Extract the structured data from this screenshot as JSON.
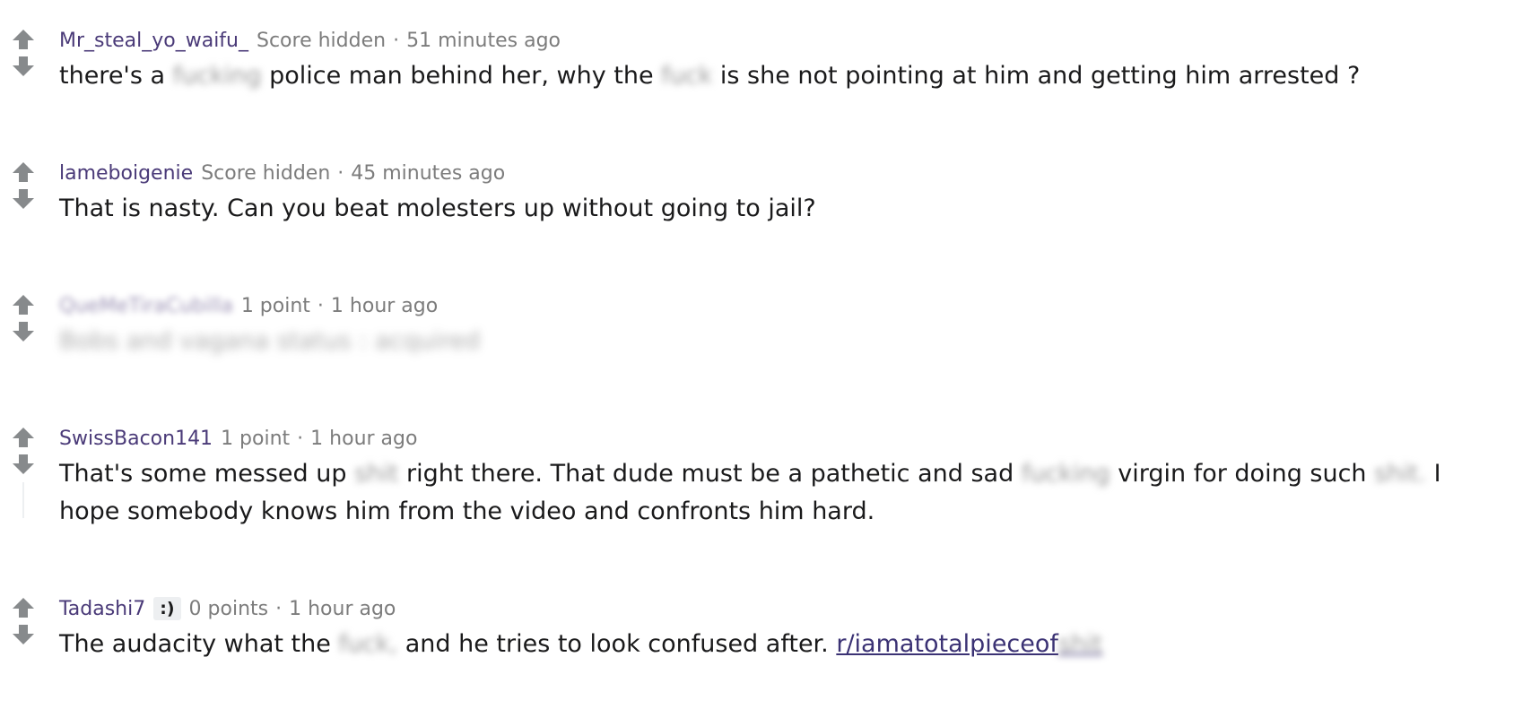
{
  "comments": [
    {
      "author": "Mr_steal_yo_waifu_",
      "score": "Score hidden",
      "separator": "·",
      "time": "51 minutes ago",
      "body": {
        "p1": "there's a ",
        "b1": "fucking",
        "p2": " police man behind her, why the ",
        "b2": "fuck",
        "p3": " is she not pointing at him and getting him arrested ?"
      }
    },
    {
      "author": "lameboigenie",
      "score": "Score hidden",
      "separator": "·",
      "time": "45 minutes ago",
      "body": {
        "p1": "That is nasty. Can you beat molesters up without going to jail?"
      }
    },
    {
      "author": "QueMeTiraCubilla",
      "score": "1 point",
      "separator": "·",
      "time": "1 hour ago",
      "body": {
        "p1": "Bobs and vagana status : acquired"
      }
    },
    {
      "author": "SwissBacon141",
      "score": "1 point",
      "separator": "·",
      "time": "1 hour ago",
      "body": {
        "p1": "That's some messed up ",
        "b1": "shit",
        "p2": " right there. That dude must be a pathetic and sad ",
        "b2": "fucking",
        "p3": " virgin for doing such ",
        "b3": "shit.",
        "p4": " I hope somebody knows him from the video and confronts him hard."
      }
    },
    {
      "author": "Tadashi7",
      "flair": ":)",
      "score": "0 points",
      "separator": "·",
      "time": "1 hour ago",
      "body": {
        "p1": "The audacity what the ",
        "b1": "fuck,",
        "p2": " and he tries to look confused after. ",
        "link_visible": "r/iamatotalpieceof",
        "link_blurred": "shit"
      }
    }
  ],
  "icons": {
    "upvote": "upvote-arrow-icon",
    "downvote": "downvote-arrow-icon"
  },
  "colors": {
    "author": "#4a3a78",
    "meta": "#7c7c7c",
    "body": "#1a1a1b",
    "vote_arrow": "#878a8c",
    "link": "#3b3274"
  }
}
